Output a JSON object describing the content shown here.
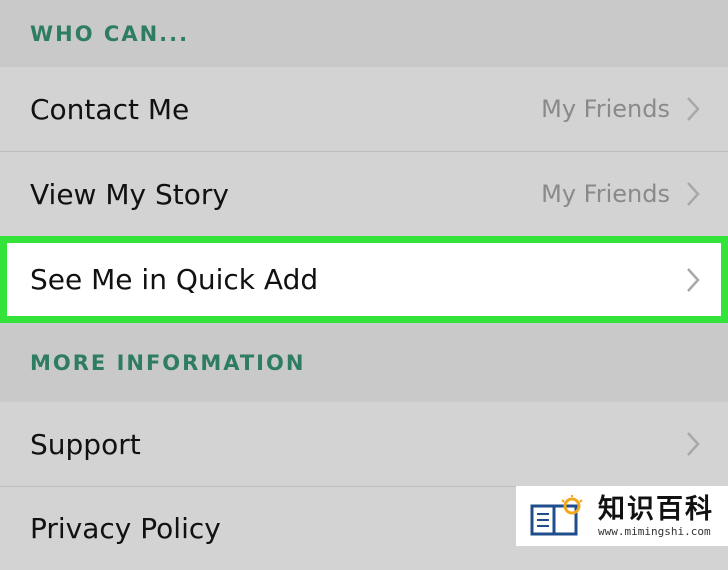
{
  "sections": {
    "who_can": {
      "header": "WHO CAN...",
      "rows": [
        {
          "label": "Contact Me",
          "value": "My Friends"
        },
        {
          "label": "View My Story",
          "value": "My Friends"
        },
        {
          "label": "See Me in Quick Add",
          "value": ""
        }
      ]
    },
    "more_information": {
      "header": "MORE INFORMATION",
      "rows": [
        {
          "label": "Support"
        },
        {
          "label": "Privacy Policy"
        }
      ]
    }
  },
  "colors": {
    "header_text": "#2e7d63",
    "highlight_border": "#33e33a",
    "value_text": "#8a8a8a",
    "chevron": "#a8a8a8"
  },
  "watermark": {
    "title": "知识百科",
    "url": "www.mimingshi.com"
  }
}
